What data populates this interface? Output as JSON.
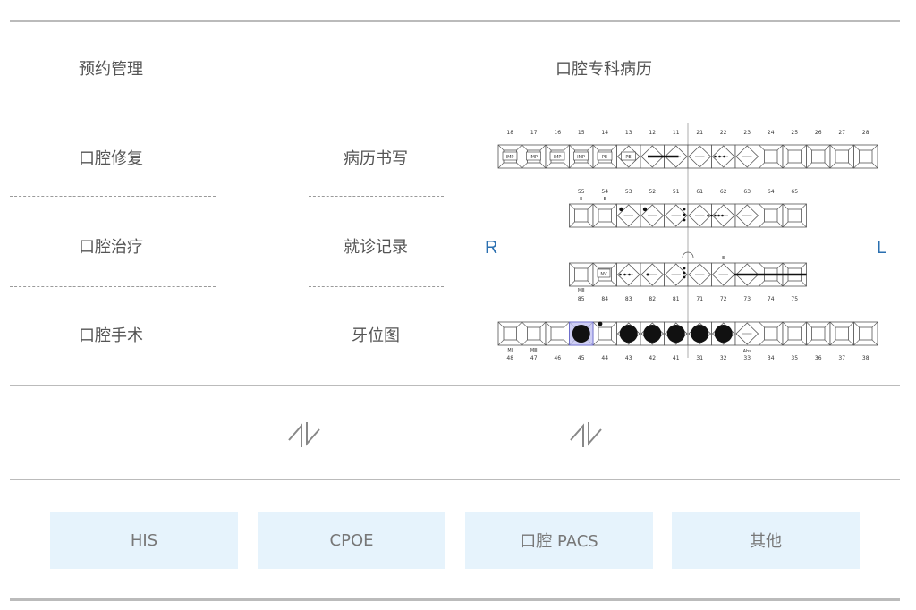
{
  "sections": {
    "left_column": [
      "预约管理",
      "口腔修复",
      "口腔治疗",
      "口腔手术"
    ],
    "middle_column": [
      "病历书写",
      "就诊记录",
      "牙位图"
    ],
    "chart_title": "口腔专科病历"
  },
  "odontogram": {
    "side_right": "R",
    "side_left": "L",
    "upper_permanent": [
      "18",
      "17",
      "16",
      "15",
      "14",
      "13",
      "12",
      "11",
      "21",
      "22",
      "23",
      "24",
      "25",
      "26",
      "27",
      "28"
    ],
    "upper_primary": [
      "55",
      "54",
      "53",
      "52",
      "51",
      "61",
      "62",
      "63",
      "64",
      "65"
    ],
    "lower_primary": [
      "85",
      "84",
      "83",
      "82",
      "81",
      "71",
      "72",
      "73",
      "74",
      "75"
    ],
    "lower_permanent": [
      "48",
      "47",
      "46",
      "45",
      "44",
      "43",
      "42",
      "41",
      "31",
      "32",
      "33",
      "34",
      "35",
      "36",
      "37",
      "38"
    ],
    "upper_tags": [
      "IMP",
      "IMP",
      "IMP",
      "IMP",
      "PE",
      "PE"
    ],
    "upper_primary_marks": [
      "E",
      "E"
    ],
    "lower_primary_tags": [
      "NV"
    ],
    "lower_primary_marks": [
      "E"
    ],
    "lower_primary_note": "MⅢ",
    "lower_permanent_notes": [
      "MⅠ",
      "MⅢ"
    ],
    "abs_label": "Abs",
    "accent": "#2a6fb0",
    "highlight": "#b9b9f0"
  },
  "systems": [
    "HIS",
    "CPOE",
    "口腔 PACS",
    "其他"
  ],
  "colors": {
    "box_bg": "#e6f3fc",
    "rule": "#bbbbbb",
    "text": "#555555"
  }
}
